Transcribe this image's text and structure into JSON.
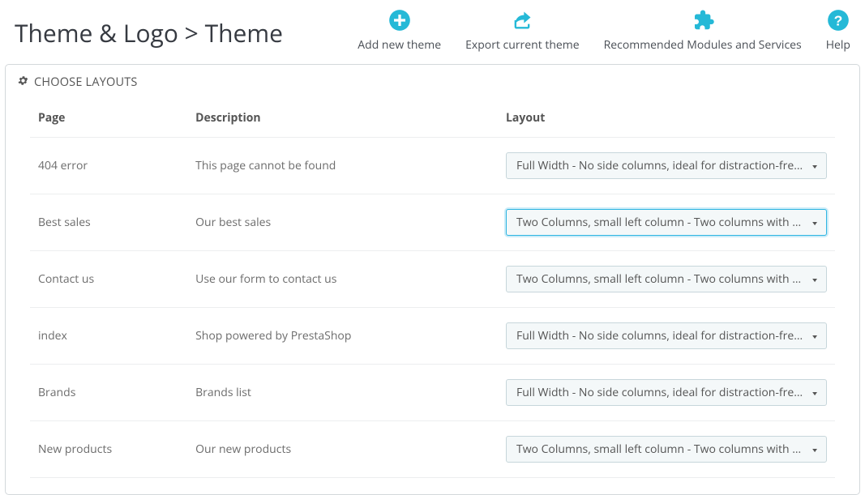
{
  "header": {
    "title": "Theme & Logo > Theme",
    "toolbar": [
      {
        "label": "Add new theme",
        "icon": "plus"
      },
      {
        "label": "Export current theme",
        "icon": "share"
      },
      {
        "label": "Recommended Modules and Services",
        "icon": "puzzle"
      },
      {
        "label": "Help",
        "icon": "help"
      }
    ]
  },
  "panel": {
    "title": "CHOOSE LAYOUTS",
    "columns": {
      "page": "Page",
      "description": "Description",
      "layout": "Layout"
    },
    "layout_options": {
      "full": "Full Width - No side columns, ideal for distraction-free pages",
      "two_left": "Two Columns, small left column - Two columns with a small left column"
    },
    "rows": [
      {
        "page": "404 error",
        "description": "This page cannot be found",
        "layout": "full",
        "focused": false
      },
      {
        "page": "Best sales",
        "description": "Our best sales",
        "layout": "two_left",
        "focused": true
      },
      {
        "page": "Contact us",
        "description": "Use our form to contact us",
        "layout": "two_left",
        "focused": false
      },
      {
        "page": "index",
        "description": "Shop powered by PrestaShop",
        "layout": "full",
        "focused": false
      },
      {
        "page": "Brands",
        "description": "Brands list",
        "layout": "full",
        "focused": false
      },
      {
        "page": "New products",
        "description": "Our new products",
        "layout": "two_left",
        "focused": false
      }
    ]
  }
}
